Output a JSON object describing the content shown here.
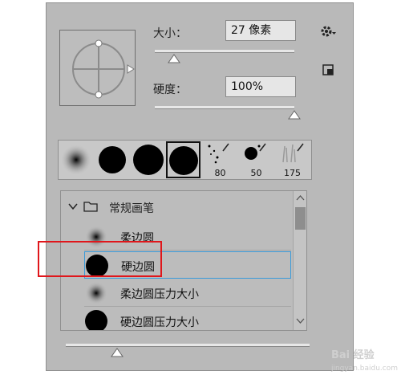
{
  "size": {
    "label": "大小：",
    "value": "27 像素",
    "slider_fraction": 0.14
  },
  "hardness": {
    "label": "硬度：",
    "value": "100%",
    "slider_fraction": 1.0
  },
  "presets": [
    {
      "kind": "soft-round",
      "number": ""
    },
    {
      "kind": "hard-round",
      "number": ""
    },
    {
      "kind": "hard-round",
      "number": ""
    },
    {
      "kind": "hard-round-selected",
      "number": ""
    },
    {
      "kind": "spatter",
      "number": "80"
    },
    {
      "kind": "ink-drop",
      "number": "50"
    },
    {
      "kind": "grass",
      "number": "175"
    }
  ],
  "group": {
    "name": "常规画笔"
  },
  "brushes": [
    {
      "name": "柔边圆",
      "kind": "soft"
    },
    {
      "name": "硬边圆",
      "kind": "hard",
      "selected": true
    },
    {
      "name": "柔边圆压力大小",
      "kind": "soft"
    },
    {
      "name": "硬边圆压力大小",
      "kind": "hard"
    }
  ],
  "bottom_slider_fraction": 0.21,
  "watermark": "Bai 经验",
  "watermark_sub": "jingyan.baidu.com",
  "colors": {
    "panel": "#b9b9b9",
    "highlight": "#e0161b",
    "selection": "#3a9ad9"
  }
}
